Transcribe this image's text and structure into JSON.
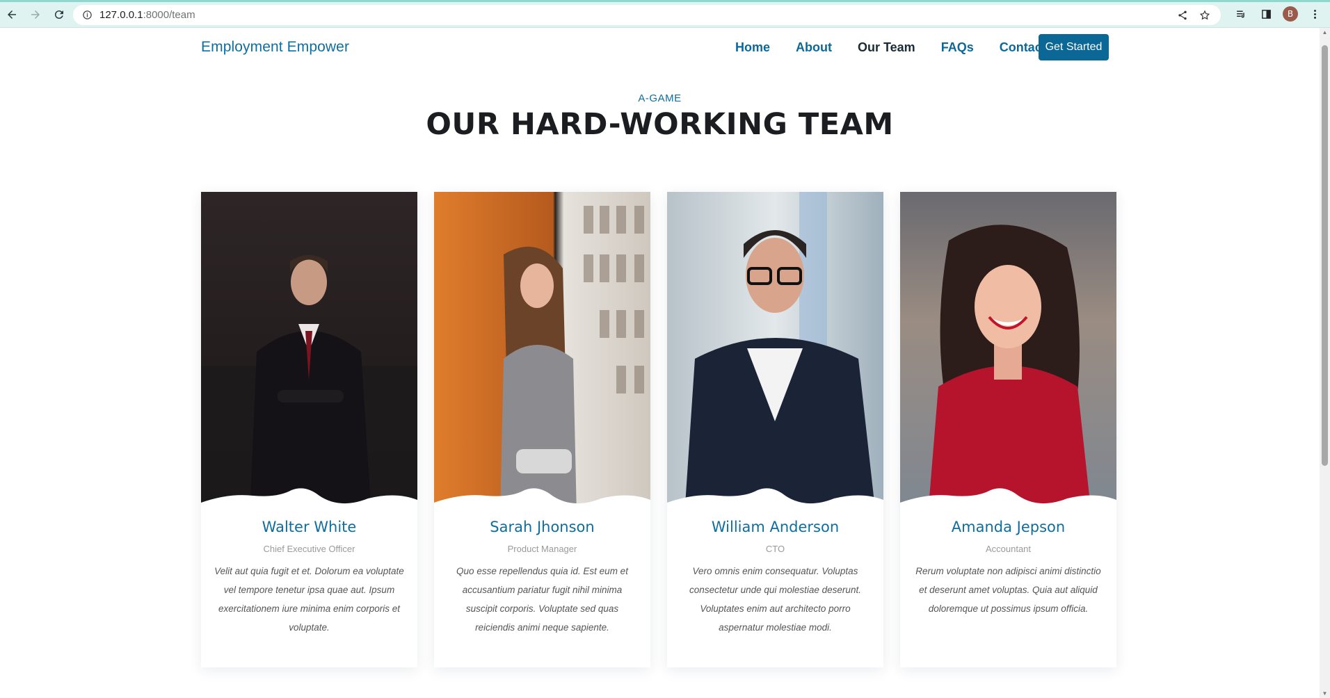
{
  "browser": {
    "url_host": "127.0.0.1",
    "url_path": ":8000/team",
    "profile_initial": "B"
  },
  "site": {
    "logo": "Employment Empower",
    "nav": [
      {
        "label": "Home",
        "active": false
      },
      {
        "label": "About",
        "active": false
      },
      {
        "label": "Our Team",
        "active": true
      },
      {
        "label": "FAQs",
        "active": false
      },
      {
        "label": "Contact",
        "active": false
      }
    ],
    "cta_label": "Get Started"
  },
  "section": {
    "tag": "A-GAME",
    "title": "OUR HARD-WORKING TEAM"
  },
  "team": [
    {
      "name": "Walter White",
      "role": "Chief Executive Officer",
      "bio": "Velit aut quia fugit et et. Dolorum ea voluptate vel tempore tenetur ipsa quae aut. Ipsum exercitationem iure minima enim corporis et voluptate."
    },
    {
      "name": "Sarah Jhonson",
      "role": "Product Manager",
      "bio": "Quo esse repellendus quia id. Est eum et accusantium pariatur fugit nihil minima suscipit corporis. Voluptate sed quas reiciendis animi neque sapiente."
    },
    {
      "name": "William Anderson",
      "role": "CTO",
      "bio": "Vero omnis enim consequatur. Voluptas consectetur unde qui molestiae deserunt. Voluptates enim aut architecto porro aspernatur molestiae modi."
    },
    {
      "name": "Amanda Jepson",
      "role": "Accountant",
      "bio": "Rerum voluptate non adipisci animi distinctio et deserunt amet voluptas. Quia aut aliquid doloremque ut possimus ipsum officia."
    }
  ],
  "colors": {
    "brand": "#0d6e9f",
    "cta_bg": "#0a6796",
    "heading": "#1b1d21",
    "chrome_bg": "#dff3f1"
  }
}
